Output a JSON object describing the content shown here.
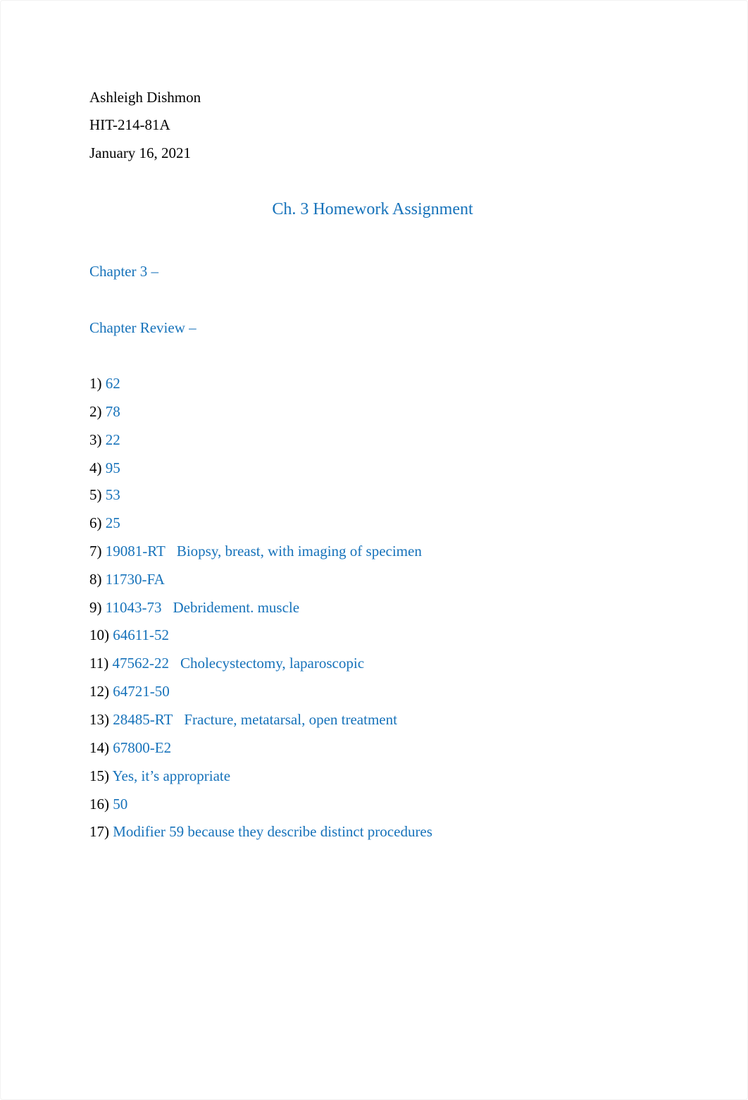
{
  "header": {
    "name": "Ashleigh Dishmon",
    "course": "HIT-214-81A",
    "date": "January 16, 2021"
  },
  "title": "Ch. 3 Homework Assignment",
  "sections": {
    "chapter": "Chapter 3 –",
    "review": "Chapter Review –"
  },
  "colors": {
    "accent": "#1672ba",
    "text": "#000000"
  },
  "answers": [
    {
      "number": "1)",
      "code": "62",
      "description": ""
    },
    {
      "number": "2)",
      "code": "78",
      "description": ""
    },
    {
      "number": "3)",
      "code": "22",
      "description": ""
    },
    {
      "number": "4)",
      "code": "95",
      "description": ""
    },
    {
      "number": "5)",
      "code": "53",
      "description": ""
    },
    {
      "number": "6)",
      "code": "25",
      "description": ""
    },
    {
      "number": "7)",
      "code": "19081-RT",
      "description": "Biopsy, breast, with imaging of specimen"
    },
    {
      "number": "8)",
      "code": "11730-FA",
      "description": ""
    },
    {
      "number": "9)",
      "code": "11043-73",
      "description": "Debridement. muscle"
    },
    {
      "number": "10)",
      "code": "64611-52",
      "description": ""
    },
    {
      "number": "11)",
      "code": "47562-22",
      "description": "Cholecystectomy, laparoscopic"
    },
    {
      "number": "12)",
      "code": "64721-50",
      "description": ""
    },
    {
      "number": "13)",
      "code": "28485-RT",
      "description": "Fracture, metatarsal, open treatment"
    },
    {
      "number": "14)",
      "code": "67800-E2",
      "description": ""
    },
    {
      "number": "15)",
      "code": "Yes, it’s appropriate",
      "description": ""
    },
    {
      "number": "16)",
      "code": "50",
      "description": ""
    },
    {
      "number": "17)",
      "code": "Modifier 59 because they describe distinct procedures",
      "description": ""
    }
  ]
}
